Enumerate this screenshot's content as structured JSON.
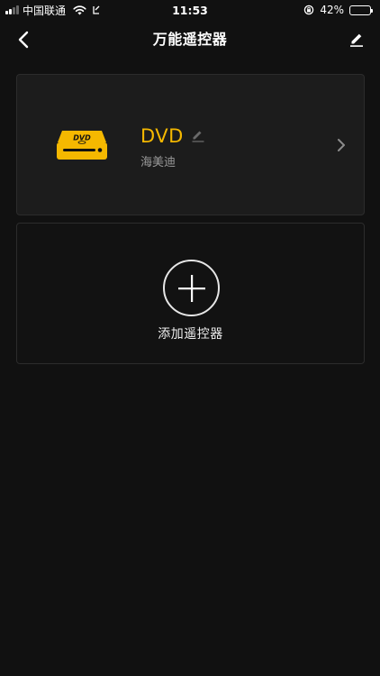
{
  "status_bar": {
    "carrier": "中国联通",
    "time": "11:53",
    "battery_percent": "42%",
    "battery_level": 0.42,
    "icons": [
      "signal-icon",
      "wifi-icon",
      "location-arrow-icon",
      "orientation-lock-icon",
      "battery-icon"
    ]
  },
  "nav": {
    "title": "万能遥控器",
    "back_icon": "chevron-left-icon",
    "edit_icon": "pencil-icon"
  },
  "devices": [
    {
      "name": "DVD",
      "brand": "海美迪",
      "icon": "dvd-player-icon",
      "icon_text": "DVD",
      "accent_color": "#f5b800"
    }
  ],
  "add_remote": {
    "label": "添加遥控器",
    "icon": "plus-icon"
  }
}
